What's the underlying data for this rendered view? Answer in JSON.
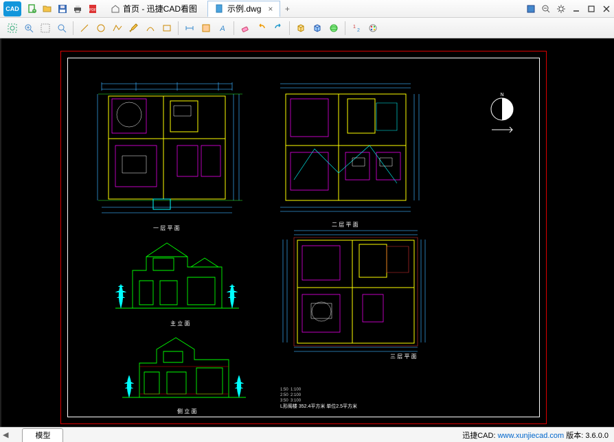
{
  "titlebar": {
    "logo_text": "CAD",
    "tabs": [
      {
        "icon": "home",
        "label": "首页 - 迅捷CAD看图",
        "active": false,
        "closeable": false
      },
      {
        "icon": "doc",
        "label": "示例.dwg",
        "active": true,
        "closeable": true
      }
    ],
    "newtab": "+"
  },
  "window_controls": {
    "items": [
      "page-icon",
      "zoom-out",
      "gear",
      "minimize",
      "maximize",
      "close"
    ]
  },
  "quick_access": {
    "items": [
      "new",
      "open",
      "save",
      "print",
      "pdf"
    ]
  },
  "toolbar": {
    "groups": [
      [
        "zoom-extents",
        "zoom-window",
        "zoom-dynamic",
        "zoom-realtime"
      ],
      [
        "line",
        "circle",
        "polyline",
        "pencil",
        "arc",
        "rect"
      ],
      [
        "dimension",
        "layer",
        "text"
      ],
      [
        "erase",
        "undo",
        "redo"
      ],
      [
        "box3d",
        "cube",
        "sphere"
      ],
      [
        "layers",
        "palette"
      ]
    ]
  },
  "canvas": {
    "bottom_tab": "模型",
    "drawing": {
      "plan1_label": "一 层 平 面",
      "plan2_label": "二 层 平 面",
      "plan3_label": "三 层 平 面",
      "elev1_label": "主 立 面",
      "elev2_label": "侧 立 面",
      "info_block": "L形阁楼   352.4平方米  单位2.5平方米"
    }
  },
  "statusbar": {
    "brand": "迅捷CAD:",
    "link": "www.xunjiecad.com",
    "version_label": "版本:",
    "version": "3.6.0.0"
  }
}
